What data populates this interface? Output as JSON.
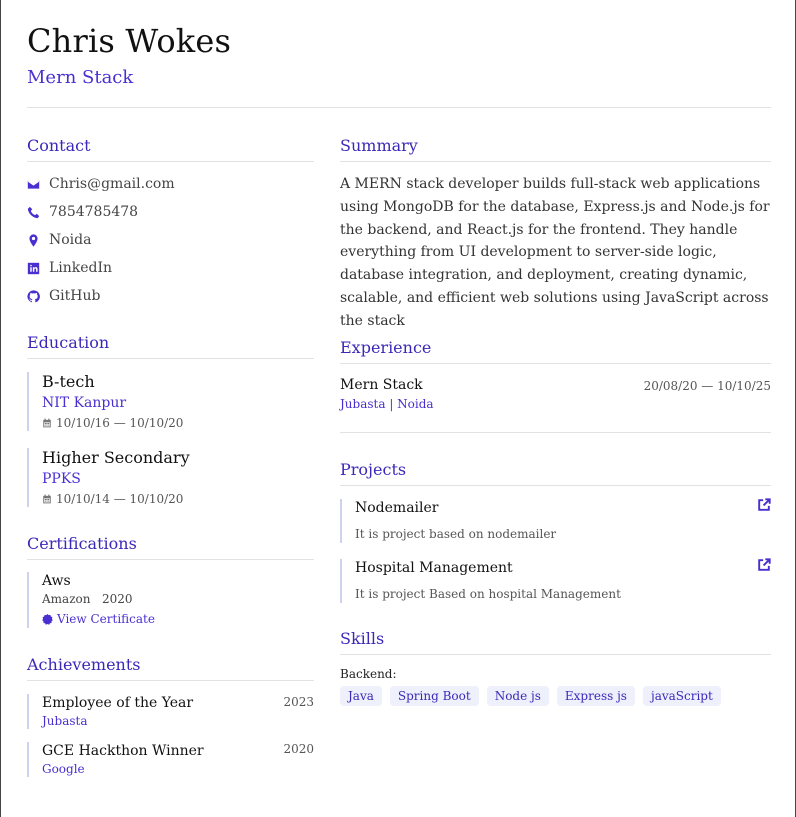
{
  "header": {
    "name": "Chris Wokes",
    "role": "Mern Stack"
  },
  "contact": {
    "title": "Contact",
    "items": [
      {
        "icon": "envelope-icon",
        "label": "Chris@gmail.com"
      },
      {
        "icon": "phone-icon",
        "label": "7854785478"
      },
      {
        "icon": "location-pin-icon",
        "label": "Noida"
      },
      {
        "icon": "linkedin-icon",
        "label": "LinkedIn"
      },
      {
        "icon": "github-icon",
        "label": "GitHub"
      }
    ]
  },
  "education": {
    "title": "Education",
    "items": [
      {
        "degree": "B-tech",
        "school": "NIT Kanpur",
        "dates": "10/10/16 — 10/10/20"
      },
      {
        "degree": "Higher Secondary",
        "school": "PPKS",
        "dates": "10/10/14 — 10/10/20"
      }
    ]
  },
  "certifications": {
    "title": "Certifications",
    "items": [
      {
        "name": "Aws",
        "issuer": "Amazon",
        "year": "2020",
        "link_label": "View Certificate"
      }
    ]
  },
  "achievements": {
    "title": "Achievements",
    "items": [
      {
        "title": "Employee of the Year",
        "org": "Jubasta",
        "year": "2023"
      },
      {
        "title": "GCE Hackthon Winner",
        "org": "Google",
        "year": "2020"
      }
    ]
  },
  "summary": {
    "title": "Summary",
    "text": "A MERN stack developer builds full-stack web applications using MongoDB for the database, Express.js and Node.js for the backend, and React.js for the frontend. They handle everything from UI development to server-side logic, database integration, and deployment, creating dynamic, scalable, and efficient web solutions using JavaScript across the stack"
  },
  "experience": {
    "title": "Experience",
    "items": [
      {
        "role": "Mern Stack",
        "company": "Jubasta | Noida",
        "dates": "20/08/20 — 10/10/25"
      }
    ]
  },
  "projects": {
    "title": "Projects",
    "items": [
      {
        "name": "Nodemailer",
        "description": "It is project based on nodemailer"
      },
      {
        "name": "Hospital Management",
        "description": "It is project Based on hospital Management"
      }
    ]
  },
  "skills": {
    "title": "Skills",
    "category": "Backend:",
    "items": [
      "Java",
      "Spring Boot",
      "Node js",
      "Express js",
      "javaScript"
    ]
  },
  "colors": {
    "accent": "#4a2fd0",
    "heading": "#3c28b8",
    "chip_bg": "#eef0fb",
    "divider": "#e2e2e2"
  }
}
